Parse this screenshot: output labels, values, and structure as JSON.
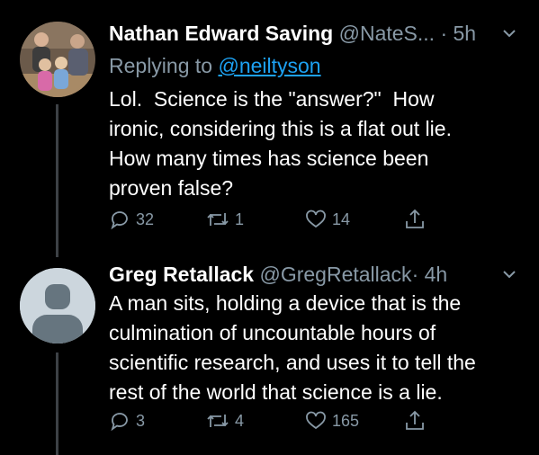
{
  "colors": {
    "background": "#000000",
    "text": "#ffffff",
    "secondary": "#8899a6",
    "link": "#1da1f2",
    "thread": "#3d4146"
  },
  "tweets": [
    {
      "name": "Nathan Edward Saving",
      "handle": "@NateS...",
      "dot": "·",
      "time": "5h",
      "reply_prefix": "Replying to",
      "reply_to": "@neiltyson",
      "text": "Lol.  Science is the \"answer?\"  How\nironic, considering this is a flat out lie.\nHow many times has science been\nproven false?",
      "replies": "32",
      "retweets": "1",
      "likes": "14",
      "avatar": "family-photo-avatar"
    },
    {
      "name": "Greg Retallack",
      "handle": "@GregRetallack",
      "dot": "·",
      "time": "4h",
      "text": "A man sits, holding a device that is the\nculmination of uncountable hours of\nscientific research, and uses it to tell the\nrest of the world that science is a lie.",
      "replies": "3",
      "retweets": "4",
      "likes": "165",
      "avatar": "default-avatar"
    }
  ],
  "icons": {
    "reply": "reply-icon",
    "retweet": "retweet-icon",
    "like": "heart-icon",
    "share": "share-icon",
    "menu": "chevron-down-icon"
  }
}
